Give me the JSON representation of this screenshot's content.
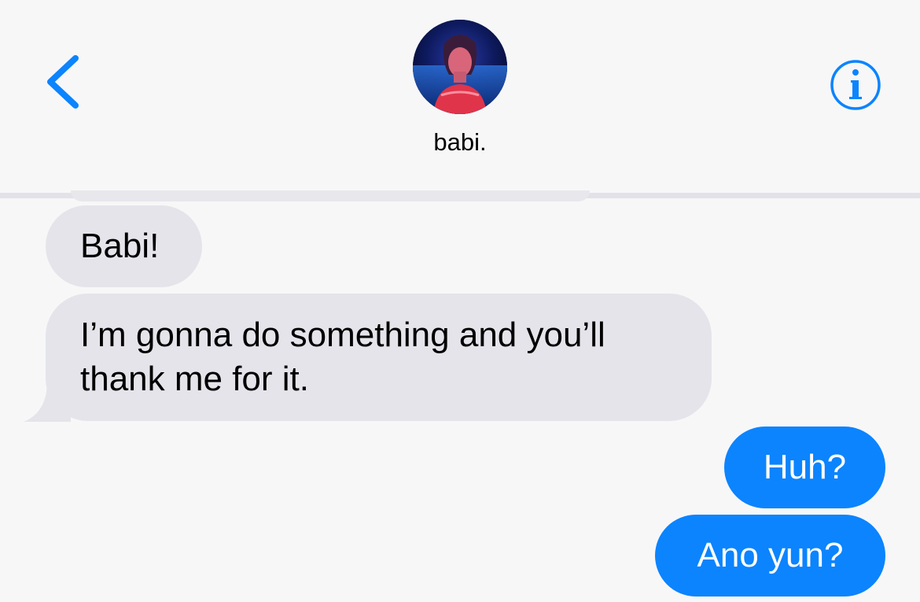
{
  "header": {
    "contact_name": "babi."
  },
  "messages": [
    {
      "direction": "incoming",
      "text": "Babi!"
    },
    {
      "direction": "incoming",
      "text": "I’m gonna do something and you’ll thank me for it."
    },
    {
      "direction": "outgoing",
      "text": "Huh?"
    },
    {
      "direction": "outgoing",
      "text": "Ano yun?"
    }
  ],
  "icons": {
    "back": "chevron-left-icon",
    "info": "info-icon"
  },
  "colors": {
    "accent": "#0b84fe",
    "incoming_bubble": "#e5e4ea",
    "background": "#f7f7f8"
  }
}
